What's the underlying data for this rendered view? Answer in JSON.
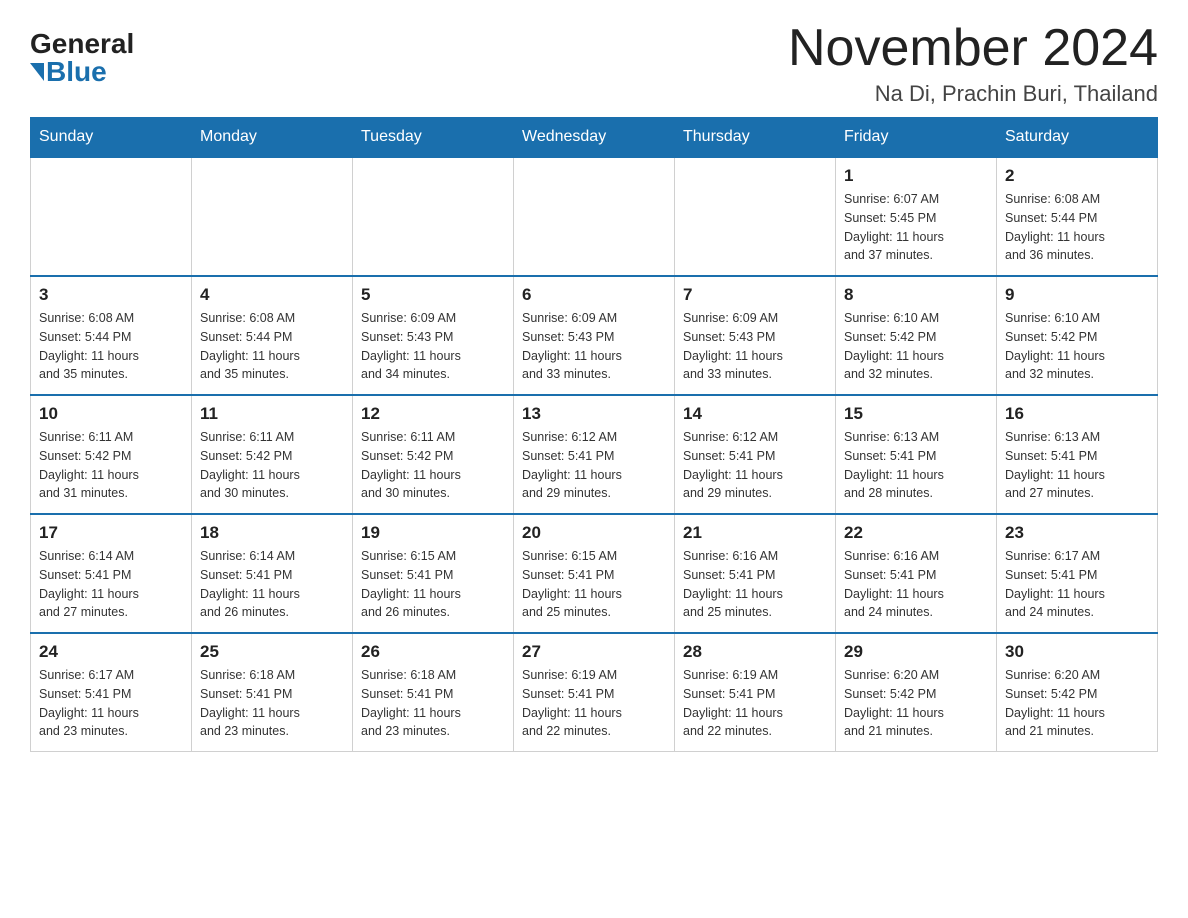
{
  "header": {
    "logo_general": "General",
    "logo_blue": "Blue",
    "month_title": "November 2024",
    "location": "Na Di, Prachin Buri, Thailand"
  },
  "weekdays": [
    "Sunday",
    "Monday",
    "Tuesday",
    "Wednesday",
    "Thursday",
    "Friday",
    "Saturday"
  ],
  "weeks": [
    [
      {
        "day": "",
        "info": ""
      },
      {
        "day": "",
        "info": ""
      },
      {
        "day": "",
        "info": ""
      },
      {
        "day": "",
        "info": ""
      },
      {
        "day": "",
        "info": ""
      },
      {
        "day": "1",
        "info": "Sunrise: 6:07 AM\nSunset: 5:45 PM\nDaylight: 11 hours\nand 37 minutes."
      },
      {
        "day": "2",
        "info": "Sunrise: 6:08 AM\nSunset: 5:44 PM\nDaylight: 11 hours\nand 36 minutes."
      }
    ],
    [
      {
        "day": "3",
        "info": "Sunrise: 6:08 AM\nSunset: 5:44 PM\nDaylight: 11 hours\nand 35 minutes."
      },
      {
        "day": "4",
        "info": "Sunrise: 6:08 AM\nSunset: 5:44 PM\nDaylight: 11 hours\nand 35 minutes."
      },
      {
        "day": "5",
        "info": "Sunrise: 6:09 AM\nSunset: 5:43 PM\nDaylight: 11 hours\nand 34 minutes."
      },
      {
        "day": "6",
        "info": "Sunrise: 6:09 AM\nSunset: 5:43 PM\nDaylight: 11 hours\nand 33 minutes."
      },
      {
        "day": "7",
        "info": "Sunrise: 6:09 AM\nSunset: 5:43 PM\nDaylight: 11 hours\nand 33 minutes."
      },
      {
        "day": "8",
        "info": "Sunrise: 6:10 AM\nSunset: 5:42 PM\nDaylight: 11 hours\nand 32 minutes."
      },
      {
        "day": "9",
        "info": "Sunrise: 6:10 AM\nSunset: 5:42 PM\nDaylight: 11 hours\nand 32 minutes."
      }
    ],
    [
      {
        "day": "10",
        "info": "Sunrise: 6:11 AM\nSunset: 5:42 PM\nDaylight: 11 hours\nand 31 minutes."
      },
      {
        "day": "11",
        "info": "Sunrise: 6:11 AM\nSunset: 5:42 PM\nDaylight: 11 hours\nand 30 minutes."
      },
      {
        "day": "12",
        "info": "Sunrise: 6:11 AM\nSunset: 5:42 PM\nDaylight: 11 hours\nand 30 minutes."
      },
      {
        "day": "13",
        "info": "Sunrise: 6:12 AM\nSunset: 5:41 PM\nDaylight: 11 hours\nand 29 minutes."
      },
      {
        "day": "14",
        "info": "Sunrise: 6:12 AM\nSunset: 5:41 PM\nDaylight: 11 hours\nand 29 minutes."
      },
      {
        "day": "15",
        "info": "Sunrise: 6:13 AM\nSunset: 5:41 PM\nDaylight: 11 hours\nand 28 minutes."
      },
      {
        "day": "16",
        "info": "Sunrise: 6:13 AM\nSunset: 5:41 PM\nDaylight: 11 hours\nand 27 minutes."
      }
    ],
    [
      {
        "day": "17",
        "info": "Sunrise: 6:14 AM\nSunset: 5:41 PM\nDaylight: 11 hours\nand 27 minutes."
      },
      {
        "day": "18",
        "info": "Sunrise: 6:14 AM\nSunset: 5:41 PM\nDaylight: 11 hours\nand 26 minutes."
      },
      {
        "day": "19",
        "info": "Sunrise: 6:15 AM\nSunset: 5:41 PM\nDaylight: 11 hours\nand 26 minutes."
      },
      {
        "day": "20",
        "info": "Sunrise: 6:15 AM\nSunset: 5:41 PM\nDaylight: 11 hours\nand 25 minutes."
      },
      {
        "day": "21",
        "info": "Sunrise: 6:16 AM\nSunset: 5:41 PM\nDaylight: 11 hours\nand 25 minutes."
      },
      {
        "day": "22",
        "info": "Sunrise: 6:16 AM\nSunset: 5:41 PM\nDaylight: 11 hours\nand 24 minutes."
      },
      {
        "day": "23",
        "info": "Sunrise: 6:17 AM\nSunset: 5:41 PM\nDaylight: 11 hours\nand 24 minutes."
      }
    ],
    [
      {
        "day": "24",
        "info": "Sunrise: 6:17 AM\nSunset: 5:41 PM\nDaylight: 11 hours\nand 23 minutes."
      },
      {
        "day": "25",
        "info": "Sunrise: 6:18 AM\nSunset: 5:41 PM\nDaylight: 11 hours\nand 23 minutes."
      },
      {
        "day": "26",
        "info": "Sunrise: 6:18 AM\nSunset: 5:41 PM\nDaylight: 11 hours\nand 23 minutes."
      },
      {
        "day": "27",
        "info": "Sunrise: 6:19 AM\nSunset: 5:41 PM\nDaylight: 11 hours\nand 22 minutes."
      },
      {
        "day": "28",
        "info": "Sunrise: 6:19 AM\nSunset: 5:41 PM\nDaylight: 11 hours\nand 22 minutes."
      },
      {
        "day": "29",
        "info": "Sunrise: 6:20 AM\nSunset: 5:42 PM\nDaylight: 11 hours\nand 21 minutes."
      },
      {
        "day": "30",
        "info": "Sunrise: 6:20 AM\nSunset: 5:42 PM\nDaylight: 11 hours\nand 21 minutes."
      }
    ]
  ]
}
